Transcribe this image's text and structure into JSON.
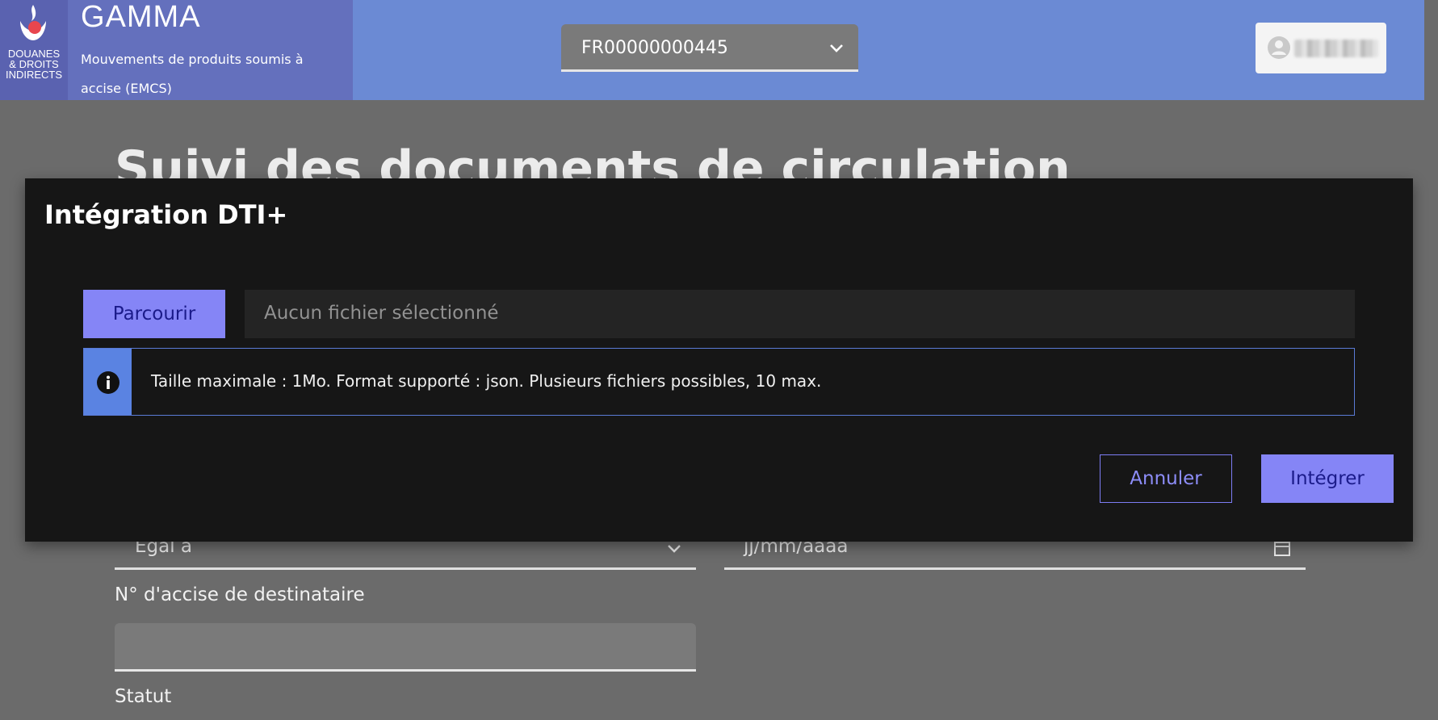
{
  "header": {
    "logo_lines": [
      "DOUANES",
      "& DROITS",
      "INDIRECTS"
    ],
    "app_name": "GAMMA",
    "app_subtitle": "Mouvements de produits soumis à accise (EMCS)",
    "operator": {
      "value": "FR00000000445"
    },
    "user": {
      "name_hidden": true
    }
  },
  "page": {
    "title": "Suivi des documents de circulation",
    "filters": {
      "operator_select": "Egal à",
      "date_placeholder": "jj/mm/aaaa",
      "recipient_label": "N° d'accise de destinataire",
      "recipient_value": "",
      "status_label": "Statut"
    }
  },
  "modal": {
    "title": "Intégration DTI+",
    "browse_label": "Parcourir",
    "file_placeholder": "Aucun fichier sélectionné",
    "info_text": "Taille maximale : 1Mo. Format supporté : json. Plusieurs fichiers possibles, 10 max.",
    "cancel_label": "Annuler",
    "submit_label": "Intégrer"
  },
  "icons": {
    "logo": "marianne-flame-icon",
    "operator_dropdown": "chevron-down-icon",
    "user": "user-circle-icon",
    "info": "info-icon",
    "calendar": "calendar-icon"
  },
  "colors": {
    "primary": "#8585f6",
    "primary_text": "#1b1b8a",
    "header": "#6b8ad4",
    "brand_block": "#6470bd",
    "info_accent": "#5a83e2",
    "modal_bg": "#161616",
    "overlay": "#6b6b6b"
  }
}
